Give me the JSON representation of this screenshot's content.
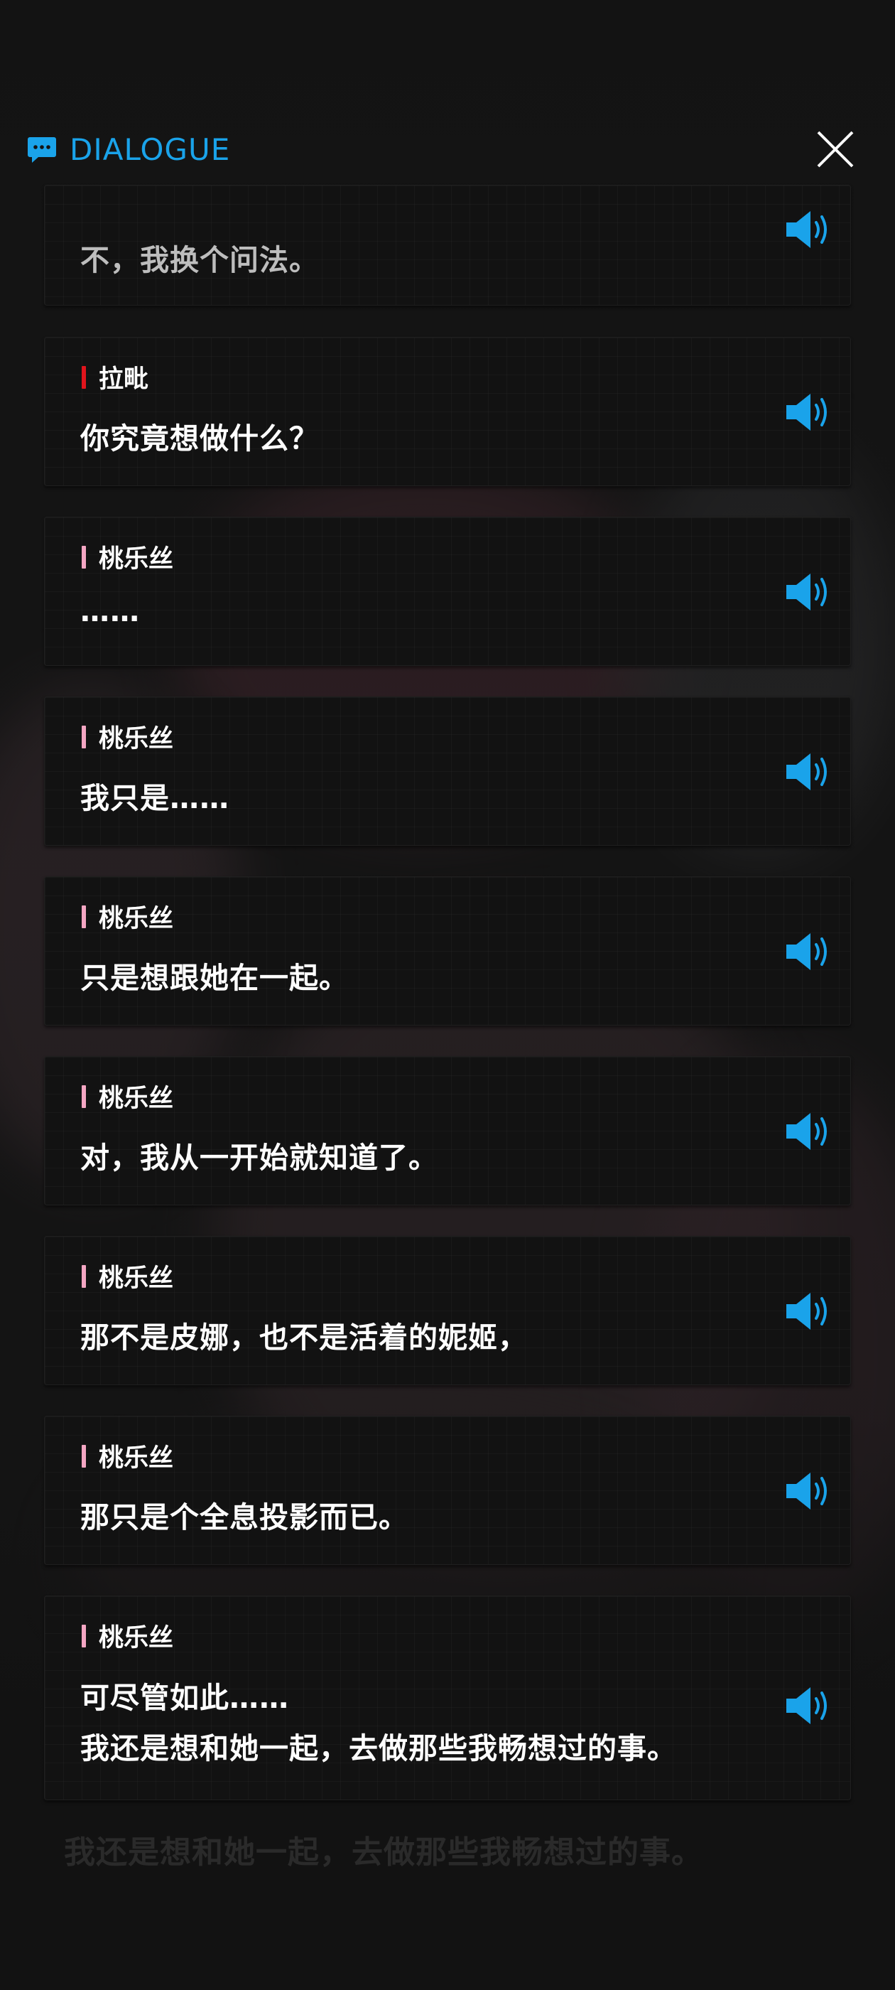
{
  "header": {
    "title": "DIALOGUE",
    "title_icon": "chat-bubble-icon",
    "close_icon": "close-icon"
  },
  "colors": {
    "accent_blue": "#1aa3ea",
    "laplace_bar": "#e0141c",
    "rapunzel_bar": "#f4a6c3",
    "card_bg": "#121212"
  },
  "dialogue": [
    {
      "speaker": "",
      "lines": [
        "不，我换个问法。"
      ],
      "voice_icon": "speaker-volume-icon"
    },
    {
      "speaker": "拉毗",
      "lines": [
        "你究竟想做什么？"
      ],
      "speaker_color": "#e0141c",
      "voice_icon": "speaker-volume-icon"
    },
    {
      "speaker": "桃乐丝",
      "lines": [
        "……"
      ],
      "speaker_color": "#f4a6c3",
      "voice_icon": "speaker-volume-icon"
    },
    {
      "speaker": "桃乐丝",
      "lines": [
        "我只是……"
      ],
      "speaker_color": "#f4a6c3",
      "voice_icon": "speaker-volume-icon"
    },
    {
      "speaker": "桃乐丝",
      "lines": [
        "只是想跟她在一起。"
      ],
      "speaker_color": "#f4a6c3",
      "voice_icon": "speaker-volume-icon"
    },
    {
      "speaker": "桃乐丝",
      "lines": [
        "对，我从一开始就知道了。"
      ],
      "speaker_color": "#f4a6c3",
      "voice_icon": "speaker-volume-icon"
    },
    {
      "speaker": "桃乐丝",
      "lines": [
        "那不是皮娜，也不是活着的妮姬，"
      ],
      "speaker_color": "#f4a6c3",
      "voice_icon": "speaker-volume-icon"
    },
    {
      "speaker": "桃乐丝",
      "lines": [
        "那只是个全息投影而已。"
      ],
      "speaker_color": "#f4a6c3",
      "voice_icon": "speaker-volume-icon"
    },
    {
      "speaker": "桃乐丝",
      "lines": [
        "可尽管如此……",
        "我还是想和她一起，去做那些我畅想过的事。"
      ],
      "speaker_color": "#f4a6c3",
      "voice_icon": "speaker-volume-icon"
    }
  ],
  "background_caption": "我还是想和她一起，去做那些我畅想过的事。"
}
